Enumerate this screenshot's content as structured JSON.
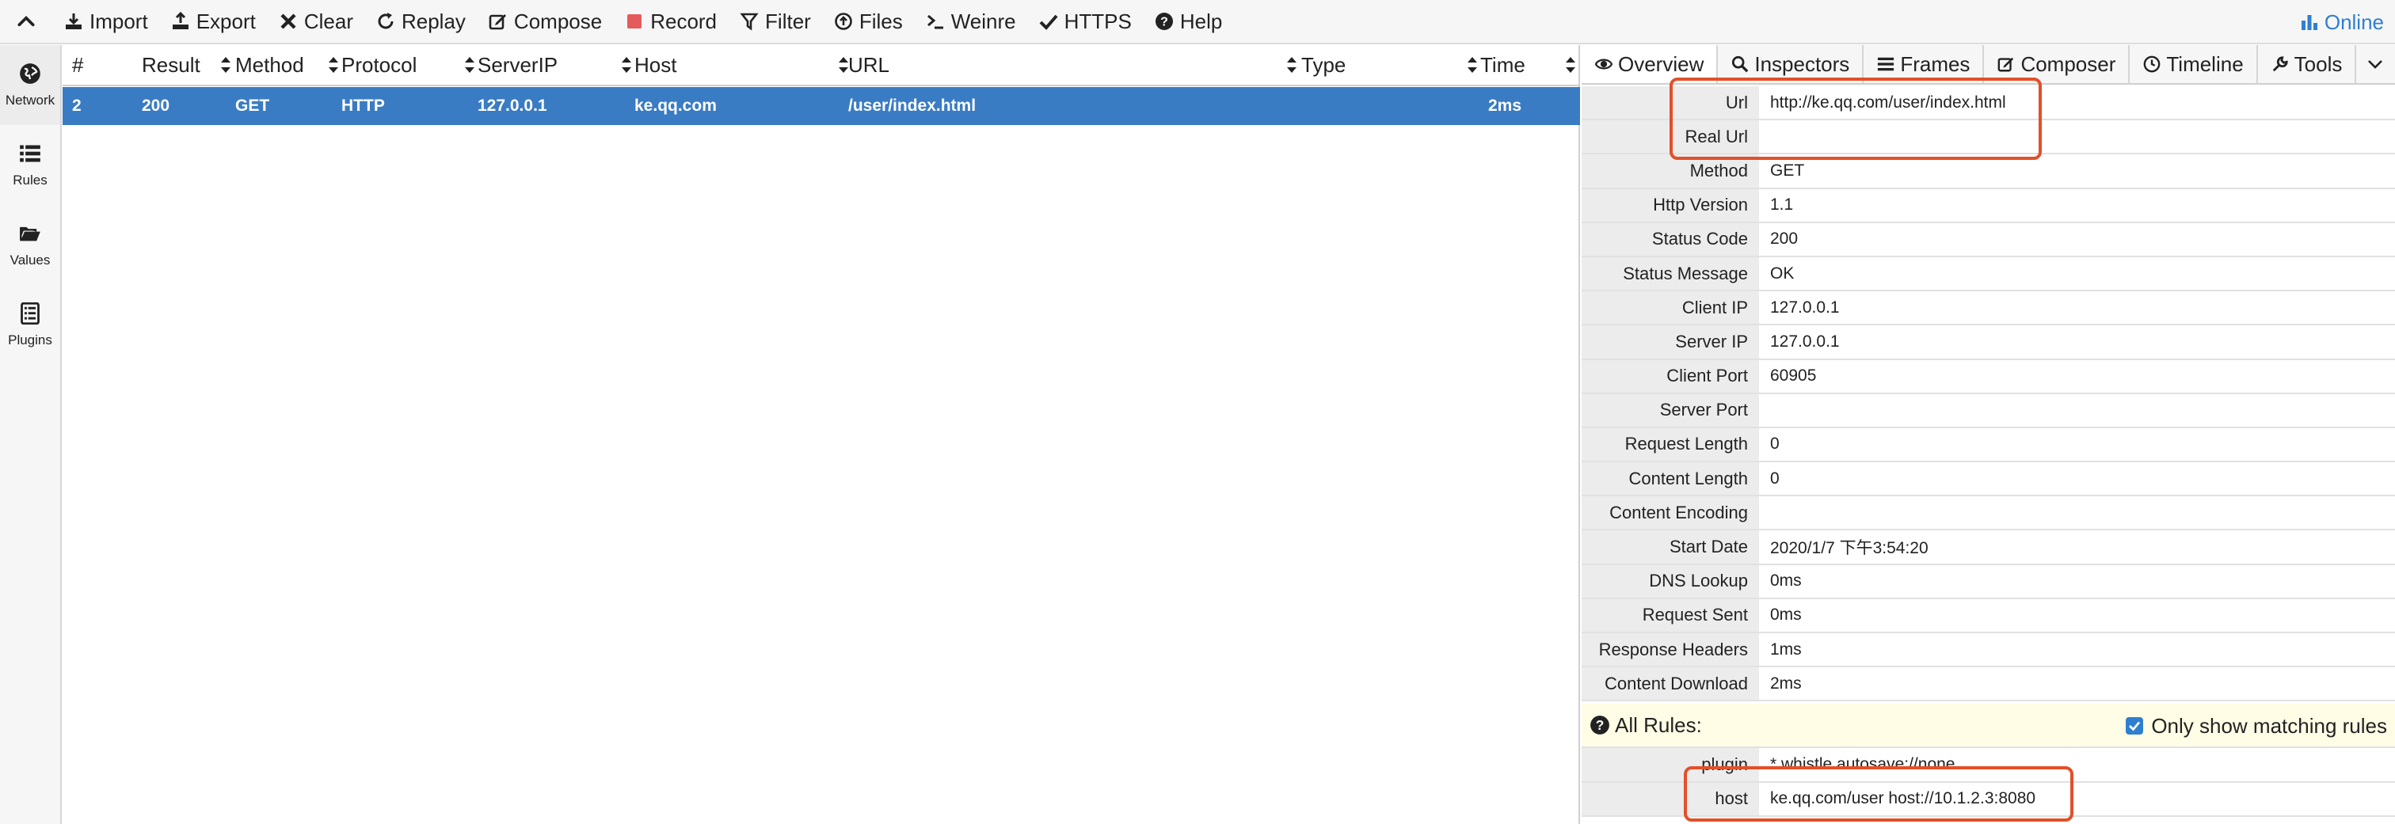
{
  "toolbar": {
    "buttons": [
      {
        "label": "Import",
        "icon": "import-icon"
      },
      {
        "label": "Export",
        "icon": "export-icon"
      },
      {
        "label": "Clear",
        "icon": "close-icon"
      },
      {
        "label": "Replay",
        "icon": "refresh-icon"
      },
      {
        "label": "Compose",
        "icon": "edit-icon"
      },
      {
        "label": "Record",
        "icon": "record-icon"
      },
      {
        "label": "Filter",
        "icon": "filter-icon"
      },
      {
        "label": "Files",
        "icon": "upload-circle-icon"
      },
      {
        "label": "Weinre",
        "icon": "terminal-icon"
      },
      {
        "label": "HTTPS",
        "icon": "check-icon"
      },
      {
        "label": "Help",
        "icon": "help-icon"
      }
    ],
    "status": "Online"
  },
  "sidebar": {
    "items": [
      {
        "label": "Network",
        "icon": "globe-icon",
        "active": true
      },
      {
        "label": "Rules",
        "icon": "list-icon",
        "active": false
      },
      {
        "label": "Values",
        "icon": "folder-open-icon",
        "active": false
      },
      {
        "label": "Plugins",
        "icon": "plugin-list-icon",
        "active": false
      }
    ]
  },
  "network": {
    "columns": [
      "#",
      "Result",
      "Method",
      "Protocol",
      "ServerIP",
      "Host",
      "URL",
      "Type",
      "Time"
    ],
    "rows": [
      {
        "num": "2",
        "result": "200",
        "method": "GET",
        "protocol": "HTTP",
        "server_ip": "127.0.0.1",
        "host": "ke.qq.com",
        "url": "/user/index.html",
        "type": "",
        "time": "2ms",
        "selected": true
      }
    ]
  },
  "detail": {
    "tabs": [
      {
        "label": "Overview",
        "icon": "eye-icon",
        "active": true
      },
      {
        "label": "Inspectors",
        "icon": "search-icon",
        "active": false
      },
      {
        "label": "Frames",
        "icon": "bars-icon",
        "active": false
      },
      {
        "label": "Composer",
        "icon": "edit-icon",
        "active": false
      },
      {
        "label": "Timeline",
        "icon": "clock-icon",
        "active": false
      },
      {
        "label": "Tools",
        "icon": "wrench-icon",
        "active": false
      }
    ],
    "overview": [
      {
        "key": "Url",
        "value": "http://ke.qq.com/user/index.html"
      },
      {
        "key": "Real Url",
        "value": ""
      },
      {
        "key": "Method",
        "value": "GET"
      },
      {
        "key": "Http Version",
        "value": "1.1"
      },
      {
        "key": "Status Code",
        "value": "200"
      },
      {
        "key": "Status Message",
        "value": "OK"
      },
      {
        "key": "Client IP",
        "value": "127.0.0.1"
      },
      {
        "key": "Server IP",
        "value": "127.0.0.1"
      },
      {
        "key": "Client Port",
        "value": "60905"
      },
      {
        "key": "Server Port",
        "value": ""
      },
      {
        "key": "Request Length",
        "value": "0"
      },
      {
        "key": "Content Length",
        "value": "0"
      },
      {
        "key": "Content Encoding",
        "value": ""
      },
      {
        "key": "Start Date",
        "value": "2020/1/7 下午3:54:20"
      },
      {
        "key": "DNS Lookup",
        "value": "0ms"
      },
      {
        "key": "Request Sent",
        "value": "0ms"
      },
      {
        "key": "Response Headers",
        "value": "1ms"
      },
      {
        "key": "Content Download",
        "value": "2ms"
      }
    ],
    "rules": {
      "title": "All Rules:",
      "only_matching_label": "Only show matching rules",
      "only_matching_checked": true,
      "items": [
        {
          "key": "plugin",
          "value": "* whistle.autosave://none"
        },
        {
          "key": "host",
          "value": "ke.qq.com/user host://10.1.2.3:8080"
        }
      ]
    }
  },
  "colors": {
    "selected_row": "#3a7cc3",
    "highlight": "#e2502a",
    "online": "#2f7fd1",
    "rules_bar": "#fffde5"
  }
}
